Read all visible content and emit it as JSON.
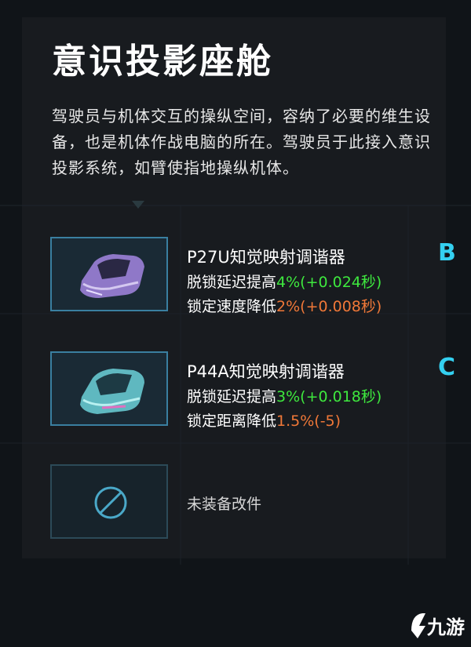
{
  "header": {
    "title": "意识投影座舱",
    "description": "驾驶员与机体交互的操纵空间，容纳了必要的维生设备，也是机体作战电脑的所在。驾驶员于此接入意识投影系统，如臂使指地操纵机体。"
  },
  "modules": [
    {
      "name": "P27U知觉映射调谐器",
      "grade": "B",
      "icon": "purple-car-icon",
      "stat1_label": "脱锁延迟提高",
      "stat1_value": "4%(+0.024秒)",
      "stat2_label": "锁定速度降低",
      "stat2_value": "2%(+0.008秒)"
    },
    {
      "name": "P44A知觉映射调谐器",
      "grade": "C",
      "icon": "teal-car-icon",
      "stat1_label": "脱锁延迟提高",
      "stat1_value": "3%(+0.018秒)",
      "stat2_label": "锁定距离降低",
      "stat2_value": "1.5%(-5)"
    }
  ],
  "empty_slot": {
    "label": "未装备改件",
    "icon": "prohibited-icon"
  },
  "watermark": {
    "text": "九游",
    "icon": "jiuyou-logo-icon"
  },
  "colors": {
    "positive": "#3ee83e",
    "negative": "#f07838",
    "grade": "#34d0f0",
    "slot_border": "#3a7fa0"
  }
}
